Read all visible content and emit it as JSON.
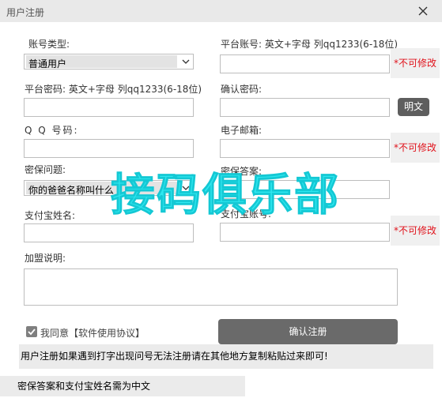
{
  "window": {
    "title": "用户注册"
  },
  "form": {
    "account_type": {
      "label": "账号类型:",
      "value": "普通用户"
    },
    "platform_account": {
      "label": "平台账号: 英文+字母 列qq1233(6-18位)",
      "value": "",
      "note": "*不可修改"
    },
    "platform_password": {
      "label": "平台密码: 英文+字母 列qq1233(6-18位)",
      "value": ""
    },
    "confirm_password": {
      "label": "确认密码:",
      "value": ""
    },
    "show_password_button": "明文",
    "qq": {
      "label": "Q Q 号码:",
      "value": ""
    },
    "email": {
      "label": "电子邮箱:",
      "value": "",
      "note": "*不可修改"
    },
    "security_question": {
      "label": "密保问题:",
      "value": "你的爸爸名称叫什么"
    },
    "security_answer": {
      "label": "密保答案:",
      "value": ""
    },
    "alipay_name": {
      "label": "支付宝姓名:",
      "value": ""
    },
    "alipay_account": {
      "label": "支付宝账号:",
      "value": "",
      "note": "*不可修改"
    },
    "join_note": {
      "label": "加盟说明:",
      "value": ""
    }
  },
  "agreement": {
    "checked": true,
    "label": "我同意【软件使用协议】"
  },
  "submit_button": "确认注册",
  "notices": [
    "用户注册如果遇到打字出现问号无法注册请在其他地方复制粘贴过来即可!",
    "密保答案和支付宝姓名需为中文"
  ],
  "watermark_text": "接码俱乐部",
  "colors": {
    "warning": "#e0121b",
    "watermark": "#2ee8f0",
    "button": "#6a6a6a"
  }
}
